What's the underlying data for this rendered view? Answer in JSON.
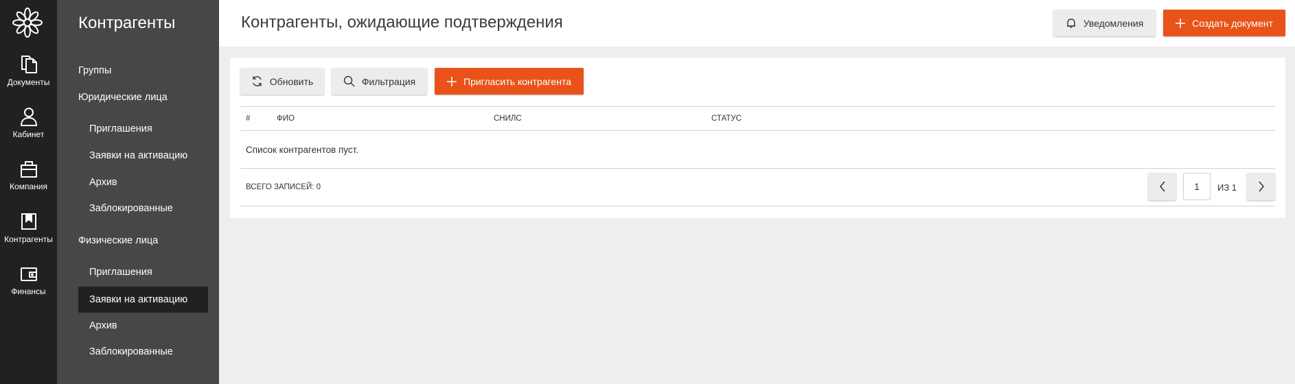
{
  "rail": {
    "items": [
      {
        "label": "Документы",
        "icon": "documents-icon"
      },
      {
        "label": "Кабинет",
        "icon": "person-icon"
      },
      {
        "label": "Компания",
        "icon": "briefcase-icon"
      },
      {
        "label": "Контрагенты",
        "icon": "bookmark-book-icon"
      },
      {
        "label": "Финансы",
        "icon": "wallet-icon"
      }
    ]
  },
  "sidebar": {
    "title": "Контрагенты",
    "groups_label": "Группы",
    "legal": {
      "label": "Юридические лица",
      "items": [
        "Приглашения",
        "Заявки на активацию",
        "Архив",
        "Заблокированные"
      ]
    },
    "individual": {
      "label": "Физические лица",
      "items": [
        "Приглашения",
        "Заявки на активацию",
        "Архив",
        "Заблокированные"
      ],
      "active_index": 1
    }
  },
  "header": {
    "title": "Контрагенты, ожидающие подтверждения",
    "notifications_label": "Уведомления",
    "create_label": "Создать документ"
  },
  "toolbar": {
    "refresh_label": "Обновить",
    "filter_label": "Фильтрация",
    "invite_label": "Пригласить контрагента"
  },
  "table": {
    "columns": [
      "#",
      "ФИО",
      "СНИЛС",
      "СТАТУС"
    ],
    "empty_text": "Список контрагентов пуст.",
    "total_label": "ВСЕГО ЗАПИСЕЙ: 0"
  },
  "pagination": {
    "current_page": "1",
    "of_label": "ИЗ 1"
  },
  "colors": {
    "accent": "#e9531a",
    "rail_bg": "#212121",
    "sidebar_bg": "#474747",
    "page_bg": "#eeeeee"
  }
}
